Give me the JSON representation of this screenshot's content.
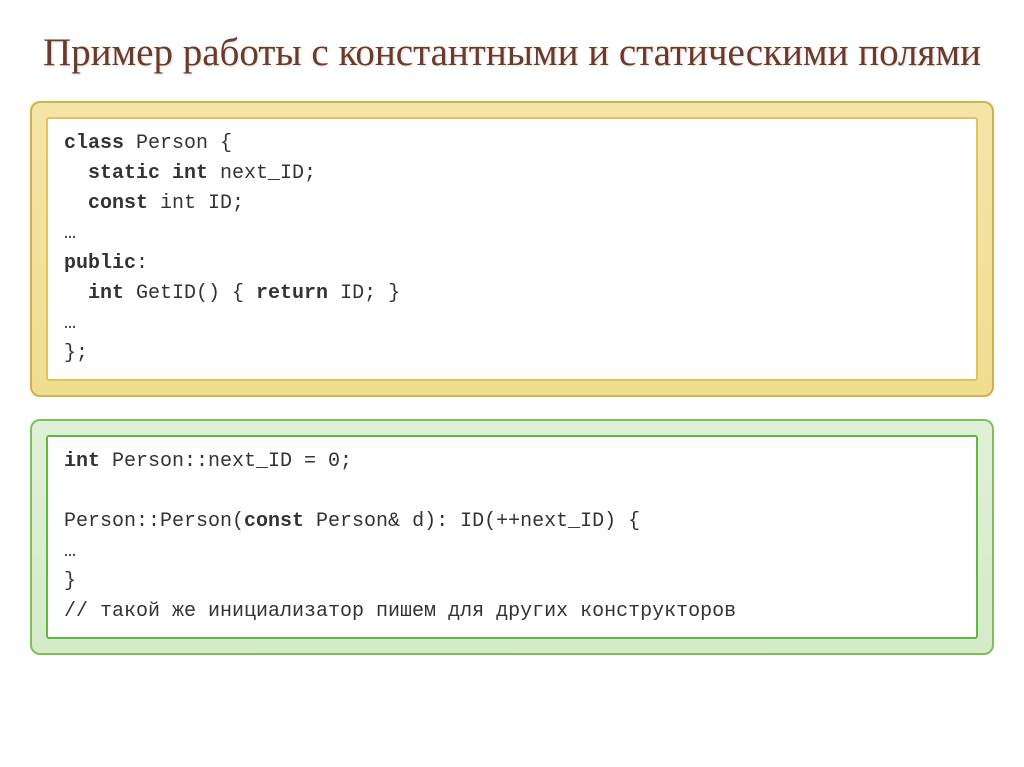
{
  "title": "Пример работы с константными и статическими полями",
  "code1": {
    "line1a": "class",
    "line1b": " Person {",
    "line2a": "  static int",
    "line2b": " next_ID;",
    "line3a": "  const",
    "line3b": " int ID;",
    "line4": "…",
    "line5a": "public",
    "line5b": ":",
    "line6a": "  int",
    "line6b": " GetID() { ",
    "line6c": "return",
    "line6d": " ID; }",
    "line7": "…",
    "line8": "};"
  },
  "code2": {
    "line1a": "int",
    "line1b": " Person::next_ID = 0;",
    "blank": " ",
    "line2a": "Person::Person(",
    "line2b": "const",
    "line2c": " Person& d): ID(++next_ID) {",
    "line3": "…",
    "line4": "}",
    "line5": "// такой же инициализатор пишем для других конструкторов"
  }
}
